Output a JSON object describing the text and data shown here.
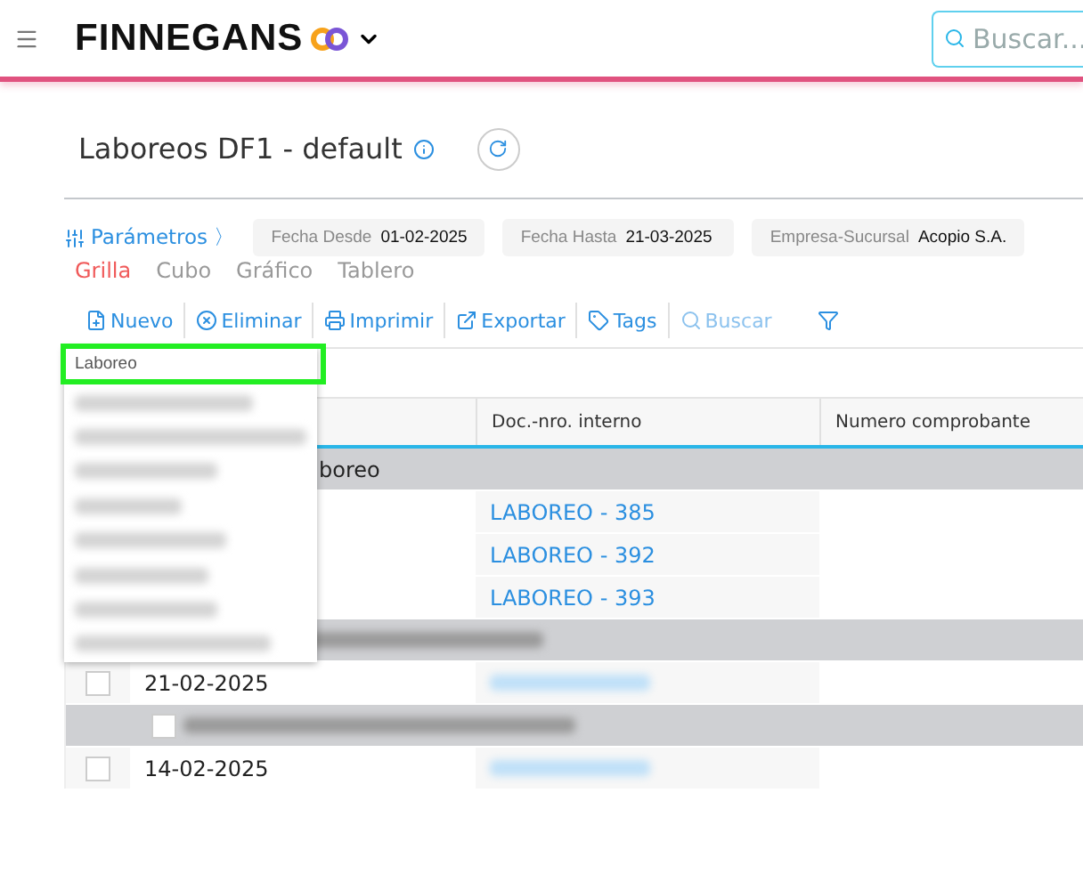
{
  "header": {
    "brand": "FINNEGANS",
    "search": {
      "placeholder": "Buscar..."
    }
  },
  "title": "Laboreos DF1 - default",
  "parameters": {
    "label": "Parámetros",
    "chevron": "〉",
    "filters": [
      {
        "label": "Fecha Desde",
        "value": "01-02-2025"
      },
      {
        "label": "Fecha Hasta",
        "value": "21-03-2025"
      },
      {
        "label": "Empresa-Sucursal",
        "value": "Acopio S.A."
      }
    ]
  },
  "tabs": [
    {
      "label": "Grilla",
      "selected": true
    },
    {
      "label": "Cubo",
      "selected": false
    },
    {
      "label": "Gráfico",
      "selected": false
    },
    {
      "label": "Tablero",
      "selected": false
    }
  ],
  "toolbar": [
    {
      "kind": "new",
      "label": "Nuevo",
      "disabled": false
    },
    {
      "kind": "delete",
      "label": "Eliminar",
      "disabled": false
    },
    {
      "kind": "print",
      "label": "Imprimir",
      "disabled": false
    },
    {
      "kind": "export",
      "label": "Exportar",
      "disabled": false
    },
    {
      "kind": "tags",
      "label": "Tags",
      "disabled": false
    },
    {
      "kind": "search",
      "label": "Buscar",
      "disabled": true
    },
    {
      "kind": "filter",
      "disabled": false
    }
  ],
  "new_menu": {
    "items": [
      {
        "label": "Laboreo",
        "highlighted": true,
        "redacted": false
      },
      {
        "redacted": true
      },
      {
        "redacted": true
      },
      {
        "redacted": true
      },
      {
        "redacted": true
      },
      {
        "redacted": true
      },
      {
        "redacted": true
      },
      {
        "redacted": true
      },
      {
        "redacted": true
      }
    ]
  },
  "table": {
    "columns": [
      "Doc.-nro. interno",
      "Numero comprobante"
    ],
    "rows": [
      {
        "kind": "group",
        "label": "boreo",
        "redacted": false
      },
      {
        "kind": "row",
        "doc": "LABOREO - 385",
        "redacted": false
      },
      {
        "kind": "row",
        "doc": "LABOREO - 392",
        "redacted": false
      },
      {
        "kind": "row",
        "doc": "LABOREO - 393",
        "redacted": false
      },
      {
        "kind": "group",
        "redacted": true
      },
      {
        "kind": "row",
        "date": "21-02-2025",
        "checked": false,
        "redacted": true
      },
      {
        "kind": "group",
        "redacted": true,
        "checked": false
      },
      {
        "kind": "row",
        "date": "14-02-2025",
        "checked": false,
        "redacted": true
      }
    ]
  }
}
